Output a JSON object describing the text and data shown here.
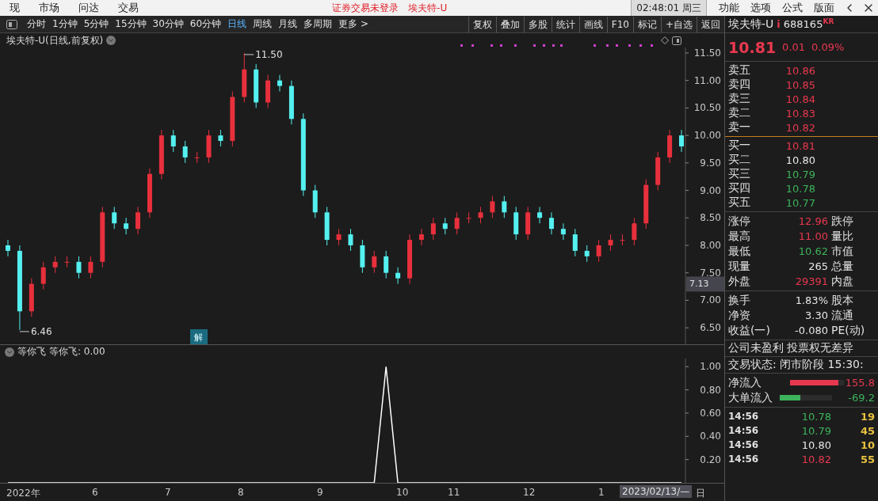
{
  "menu_bar": {
    "items": [
      "现",
      "市场",
      "问达",
      "交易"
    ],
    "status": "证券交易未登录",
    "stock": "埃夫特-U",
    "clock": "02:48:01 周三",
    "right_items": [
      "功能",
      "选项",
      "公式",
      "版面"
    ]
  },
  "toolbar": {
    "periods": [
      {
        "label": "分时",
        "selected": false
      },
      {
        "label": "1分钟",
        "selected": false
      },
      {
        "label": "5分钟",
        "selected": false
      },
      {
        "label": "15分钟",
        "selected": false
      },
      {
        "label": "30分钟",
        "selected": false
      },
      {
        "label": "60分钟",
        "selected": false
      },
      {
        "label": "日线",
        "selected": true
      },
      {
        "label": "周线",
        "selected": false
      },
      {
        "label": "月线",
        "selected": false
      },
      {
        "label": "多周期",
        "selected": false
      }
    ],
    "more": "更多 >",
    "actions": [
      "复权",
      "叠加",
      "多股",
      "统计",
      "画线",
      "F10",
      "标记",
      "+自选",
      "返回"
    ]
  },
  "main_chart": {
    "title": "埃夫特-U(日线,前复权)",
    "annotations": [
      {
        "kind": "high",
        "text": "11.50"
      },
      {
        "kind": "low",
        "text": "6.46"
      },
      {
        "kind": "marker",
        "text": "解"
      },
      {
        "kind": "price_tag",
        "text": "7.13"
      }
    ],
    "chart_data": {
      "type": "candlestick",
      "ylim": [
        6.2,
        11.6
      ],
      "yticks": [
        {
          "value": 6.5,
          "label": "6.50"
        },
        {
          "value": 7,
          "label": "7.00"
        },
        {
          "value": 7.5,
          "label": "7.50"
        },
        {
          "value": 8,
          "label": "8.00"
        },
        {
          "value": 8.5,
          "label": "8.50"
        },
        {
          "value": 9,
          "label": "9.00"
        },
        {
          "value": 9.5,
          "label": "9.50"
        },
        {
          "value": 10,
          "label": "10.00"
        },
        {
          "value": 10.5,
          "label": "10.50"
        },
        {
          "value": 11,
          "label": "11.00"
        },
        {
          "value": 11.5,
          "label": "11.50"
        }
      ],
      "categories": [
        null,
        null,
        null,
        null,
        null,
        null,
        null,
        null,
        null,
        null,
        null,
        null,
        null,
        null,
        null,
        null,
        null,
        null,
        null,
        null,
        null,
        null,
        null,
        null,
        null,
        null,
        null,
        null,
        null,
        null,
        null,
        null,
        null,
        null,
        null,
        null,
        null,
        null,
        null,
        null,
        null,
        null,
        null,
        null,
        null,
        null,
        null,
        null,
        null,
        null,
        null,
        null,
        null,
        null,
        null,
        null,
        null,
        null
      ],
      "ohlc": [
        [
          8.0,
          8.1,
          7.8,
          7.9
        ],
        [
          7.9,
          8.0,
          6.46,
          6.8
        ],
        [
          6.8,
          7.4,
          6.7,
          7.3
        ],
        [
          7.3,
          7.7,
          7.2,
          7.6
        ],
        [
          7.6,
          7.8,
          7.5,
          7.7
        ],
        [
          7.7,
          7.8,
          7.6,
          7.7
        ],
        [
          7.7,
          7.8,
          7.4,
          7.5
        ],
        [
          7.5,
          7.8,
          7.4,
          7.7
        ],
        [
          7.7,
          8.7,
          7.6,
          8.6
        ],
        [
          8.6,
          8.7,
          8.3,
          8.4
        ],
        [
          8.4,
          8.5,
          8.2,
          8.3
        ],
        [
          8.3,
          8.7,
          8.2,
          8.6
        ],
        [
          8.6,
          9.4,
          8.5,
          9.3
        ],
        [
          9.3,
          10.1,
          9.2,
          10.0
        ],
        [
          10.0,
          10.1,
          9.7,
          9.8
        ],
        [
          9.8,
          9.9,
          9.5,
          9.6
        ],
        [
          9.6,
          9.7,
          9.5,
          9.6
        ],
        [
          9.6,
          10.1,
          9.5,
          10.0
        ],
        [
          10.0,
          10.1,
          9.8,
          9.9
        ],
        [
          9.9,
          10.8,
          9.8,
          10.7
        ],
        [
          10.7,
          11.5,
          10.6,
          11.2
        ],
        [
          11.2,
          11.3,
          10.5,
          10.6
        ],
        [
          10.6,
          11.1,
          10.5,
          11.0
        ],
        [
          11.0,
          11.1,
          10.8,
          10.9
        ],
        [
          10.9,
          11.0,
          10.2,
          10.3
        ],
        [
          10.3,
          10.4,
          8.9,
          9.0
        ],
        [
          9.0,
          9.1,
          8.5,
          8.6
        ],
        [
          8.6,
          8.7,
          8.0,
          8.1
        ],
        [
          8.1,
          8.3,
          8.0,
          8.2
        ],
        [
          8.2,
          8.3,
          7.9,
          8.0
        ],
        [
          8.0,
          8.1,
          7.5,
          7.6
        ],
        [
          7.6,
          7.9,
          7.5,
          7.8
        ],
        [
          7.8,
          7.9,
          7.4,
          7.5
        ],
        [
          7.5,
          7.6,
          7.3,
          7.4
        ],
        [
          7.4,
          8.2,
          7.3,
          8.1
        ],
        [
          8.1,
          8.3,
          8.0,
          8.2
        ],
        [
          8.2,
          8.5,
          8.1,
          8.4
        ],
        [
          8.4,
          8.5,
          8.2,
          8.3
        ],
        [
          8.3,
          8.6,
          8.2,
          8.5
        ],
        [
          8.5,
          8.6,
          8.4,
          8.5
        ],
        [
          8.5,
          8.7,
          8.4,
          8.6
        ],
        [
          8.6,
          8.9,
          8.5,
          8.8
        ],
        [
          8.8,
          8.9,
          8.5,
          8.6
        ],
        [
          8.6,
          8.7,
          8.1,
          8.2
        ],
        [
          8.2,
          8.7,
          8.1,
          8.6
        ],
        [
          8.6,
          8.7,
          8.4,
          8.5
        ],
        [
          8.5,
          8.6,
          8.2,
          8.3
        ],
        [
          8.3,
          8.4,
          8.1,
          8.2
        ],
        [
          8.2,
          8.3,
          7.8,
          7.9
        ],
        [
          7.9,
          8.0,
          7.7,
          7.8
        ],
        [
          7.8,
          8.1,
          7.7,
          8.0
        ],
        [
          8.0,
          8.2,
          7.9,
          8.1
        ],
        [
          8.1,
          8.2,
          8.0,
          8.1
        ],
        [
          8.1,
          8.5,
          8.0,
          8.4
        ],
        [
          8.4,
          9.2,
          8.3,
          9.1
        ],
        [
          9.1,
          9.7,
          9.0,
          9.6
        ],
        [
          9.6,
          10.1,
          9.5,
          10.0
        ],
        [
          10.0,
          10.1,
          9.7,
          9.8
        ]
      ]
    }
  },
  "indicator": {
    "reading": "等你飞: 0.00",
    "chart_data": {
      "type": "line",
      "ylim": [
        0,
        1.07
      ],
      "yticks": [
        {
          "value": 0.2,
          "label": "0.20"
        },
        {
          "value": 0.4,
          "label": "0.40"
        },
        {
          "value": 0.6,
          "label": "0.60"
        },
        {
          "value": 0.8,
          "label": "0.80"
        },
        {
          "value": 1,
          "label": "1.00"
        }
      ],
      "categories": [
        null,
        null,
        null,
        null,
        null,
        null,
        null,
        null,
        null,
        null,
        null,
        null,
        null,
        null,
        null,
        null,
        null,
        null,
        null,
        null,
        null,
        null,
        null,
        null,
        null,
        null,
        null,
        null,
        null,
        null,
        null,
        null,
        null,
        null,
        null,
        null,
        null,
        null,
        null,
        null,
        null,
        null,
        null,
        null,
        null,
        null,
        null,
        null,
        null,
        null,
        null,
        null,
        null,
        null,
        null,
        null,
        null,
        null
      ],
      "series": [
        {
          "name": "等你飞",
          "color": "#ffffff",
          "values": [
            0,
            0,
            0,
            0,
            0,
            0,
            0,
            0,
            0,
            0,
            0,
            0,
            0,
            0,
            0,
            0,
            0,
            0,
            0,
            0,
            0,
            0,
            0,
            0,
            0,
            0,
            0,
            0,
            0,
            0,
            0,
            0,
            1,
            0,
            0,
            0,
            0,
            0,
            0,
            0,
            0,
            0,
            0,
            0,
            0,
            0,
            0,
            0,
            0,
            0,
            0,
            0,
            0,
            0,
            0,
            0,
            0,
            0
          ]
        }
      ]
    }
  },
  "time_axis": {
    "labels": [
      "2022年",
      "6",
      "7",
      "8",
      "9",
      "10",
      "11",
      "12",
      "1"
    ],
    "cursor": "2023/02/13/—",
    "period": "日"
  },
  "quote": {
    "name": "埃夫特-U",
    "flag": "i",
    "code": "688165",
    "tag": "KR",
    "price": "10.81",
    "change": "0.01",
    "percent": "0.09%"
  },
  "asks": [
    {
      "label": "卖五",
      "price": "10.86",
      "color": "#e8384f"
    },
    {
      "label": "卖四",
      "price": "10.85",
      "color": "#e8384f"
    },
    {
      "label": "卖三",
      "price": "10.84",
      "color": "#e8384f"
    },
    {
      "label": "卖二",
      "price": "10.83",
      "color": "#e8384f"
    },
    {
      "label": "卖一",
      "price": "10.82",
      "color": "#e8384f"
    }
  ],
  "bids": [
    {
      "label": "买一",
      "price": "10.81",
      "color": "#e8384f"
    },
    {
      "label": "买二",
      "price": "10.80",
      "color": "#e6e6e6"
    },
    {
      "label": "买三",
      "price": "10.79",
      "color": "#3cb35a"
    },
    {
      "label": "买四",
      "price": "10.78",
      "color": "#3cb35a"
    },
    {
      "label": "买五",
      "price": "10.77",
      "color": "#3cb35a"
    }
  ],
  "stats": [
    {
      "label": "涨停",
      "value": "12.96",
      "color": "#e8384f",
      "label2": "跌停"
    },
    {
      "label": "最高",
      "value": "11.00",
      "color": "#e8384f",
      "label2": "量比"
    },
    {
      "label": "最低",
      "value": "10.62",
      "color": "#3cb35a",
      "label2": "市值"
    },
    {
      "label": "现量",
      "value": "265",
      "color": "#e6e6e6",
      "label2": "总量"
    },
    {
      "label": "外盘",
      "value": "29391",
      "color": "#e8384f",
      "label2": "内盘"
    }
  ],
  "stats2": [
    {
      "label": "换手",
      "value": "1.83%",
      "color": "#e6e6e6",
      "label2": "股本"
    },
    {
      "label": "净资",
      "value": "3.30",
      "color": "#e6e6e6",
      "label2": "流通"
    },
    {
      "label": "收益(一)",
      "value": "-0.080",
      "color": "#e6e6e6",
      "label2": "PE(动)"
    }
  ],
  "notes": [
    "公司未盈利 投票权无差异",
    "交易状态: 闭市阶段 15:30:"
  ],
  "flows": [
    {
      "label": "净流入",
      "level": 0.9,
      "value": "155.8",
      "color": "#e8384f"
    },
    {
      "label": "大单流入",
      "level": 0.4,
      "value": "-69.2",
      "color": "#3cb35a"
    }
  ],
  "trades": [
    {
      "time": "14:56",
      "price": "10.78",
      "color": "#3cb35a",
      "volume": "19"
    },
    {
      "time": "14:56",
      "price": "10.79",
      "color": "#3cb35a",
      "volume": "45"
    },
    {
      "time": "14:56",
      "price": "10.80",
      "color": "#e6e6e6",
      "volume": "10"
    },
    {
      "time": "14:56",
      "price": "10.82",
      "color": "#e8384f",
      "volume": "55"
    }
  ]
}
